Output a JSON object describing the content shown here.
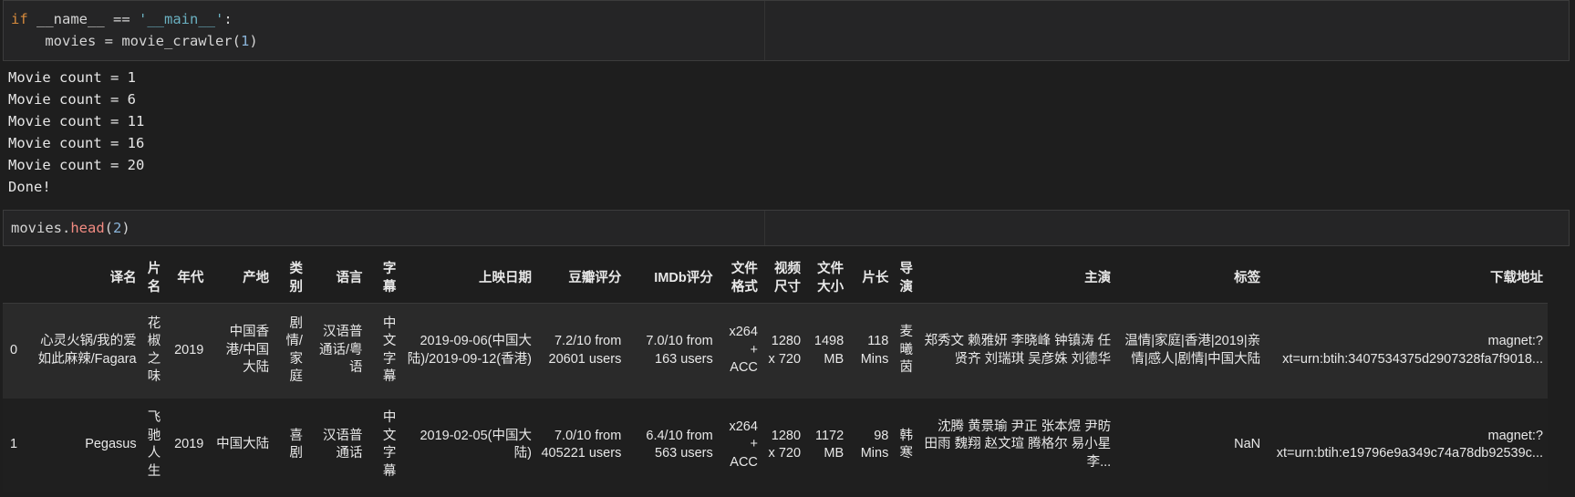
{
  "cell1": {
    "line1": {
      "kw": "if",
      "name": " __name__ == ",
      "str": "'__main__'",
      "colon": ":"
    },
    "line2": {
      "pre": "    movies = movie_crawler(",
      "num": "1",
      "post": ")"
    }
  },
  "output": {
    "lines": [
      "Movie count = 1",
      "Movie count = 6",
      "Movie count = 11",
      "Movie count = 16",
      "Movie count = 20",
      "Done!"
    ]
  },
  "cell2": {
    "obj": "movies.",
    "method": "head",
    "open": "(",
    "num": "2",
    "close": ")"
  },
  "table": {
    "headers": {
      "index": "",
      "c1": "译名",
      "c2": "片名",
      "c3": "年代",
      "c4": "产地",
      "c5": "类别",
      "c6": "语言",
      "c7": "字幕",
      "c8": "上映日期",
      "c9": "豆瓣评分",
      "c10": "IMDb评分",
      "c11": "文件格式",
      "c12": "视频尺寸",
      "c13": "文件大小",
      "c14": "片长",
      "c15": "导演",
      "c16": "主演",
      "c17": "标签",
      "c18": "下载地址"
    },
    "rows": [
      {
        "index": "0",
        "c1": "心灵火锅/我的爱如此麻辣/Fagara",
        "c2": "花椒之味",
        "c3": "2019",
        "c4": "中国香港/中国大陆",
        "c5": "剧情/家庭",
        "c6": "汉语普通话/粤语",
        "c7": "中文字幕",
        "c8": "2019-09-06(中国大陆)/2019-09-12(香港)",
        "c9": "7.2/10 from 20601 users",
        "c10": "7.0/10 from 163 users",
        "c11": "x264 + ACC",
        "c12": "1280 x 720",
        "c13": "1498 MB",
        "c14": "118 Mins",
        "c15": "麦曦茵",
        "c16": "郑秀文 赖雅妍 李晓峰 钟镇涛 任贤齐 刘瑞琪 吴彦姝 刘德华",
        "c17": "温情|家庭|香港|2019|亲情|感人|剧情|中国大陆",
        "c18a": "magnet:?",
        "c18b": "xt=urn:btih:3407534375d2907328fa7f9018..."
      },
      {
        "index": "1",
        "c1": "Pegasus",
        "c2": "飞驰人生",
        "c3": "2019",
        "c4": "中国大陆",
        "c5": "喜剧",
        "c6": "汉语普通话",
        "c7": "中文字幕",
        "c8": "2019-02-05(中国大陆)",
        "c9": "7.0/10 from 405221 users",
        "c10": "6.4/10 from 563 users",
        "c11": "x264 + ACC",
        "c12": "1280 x 720",
        "c13": "1172 MB",
        "c14": "98 Mins",
        "c15": "韩寒",
        "c16": "沈腾 黄景瑜 尹正 张本煜 尹昉 田雨 魏翔 赵文瑄 腾格尔 易小星 李...",
        "c17": "NaN",
        "c18a": "magnet:?",
        "c18b": "xt=urn:btih:e19796e9a349c74a78db92539c..."
      }
    ]
  }
}
